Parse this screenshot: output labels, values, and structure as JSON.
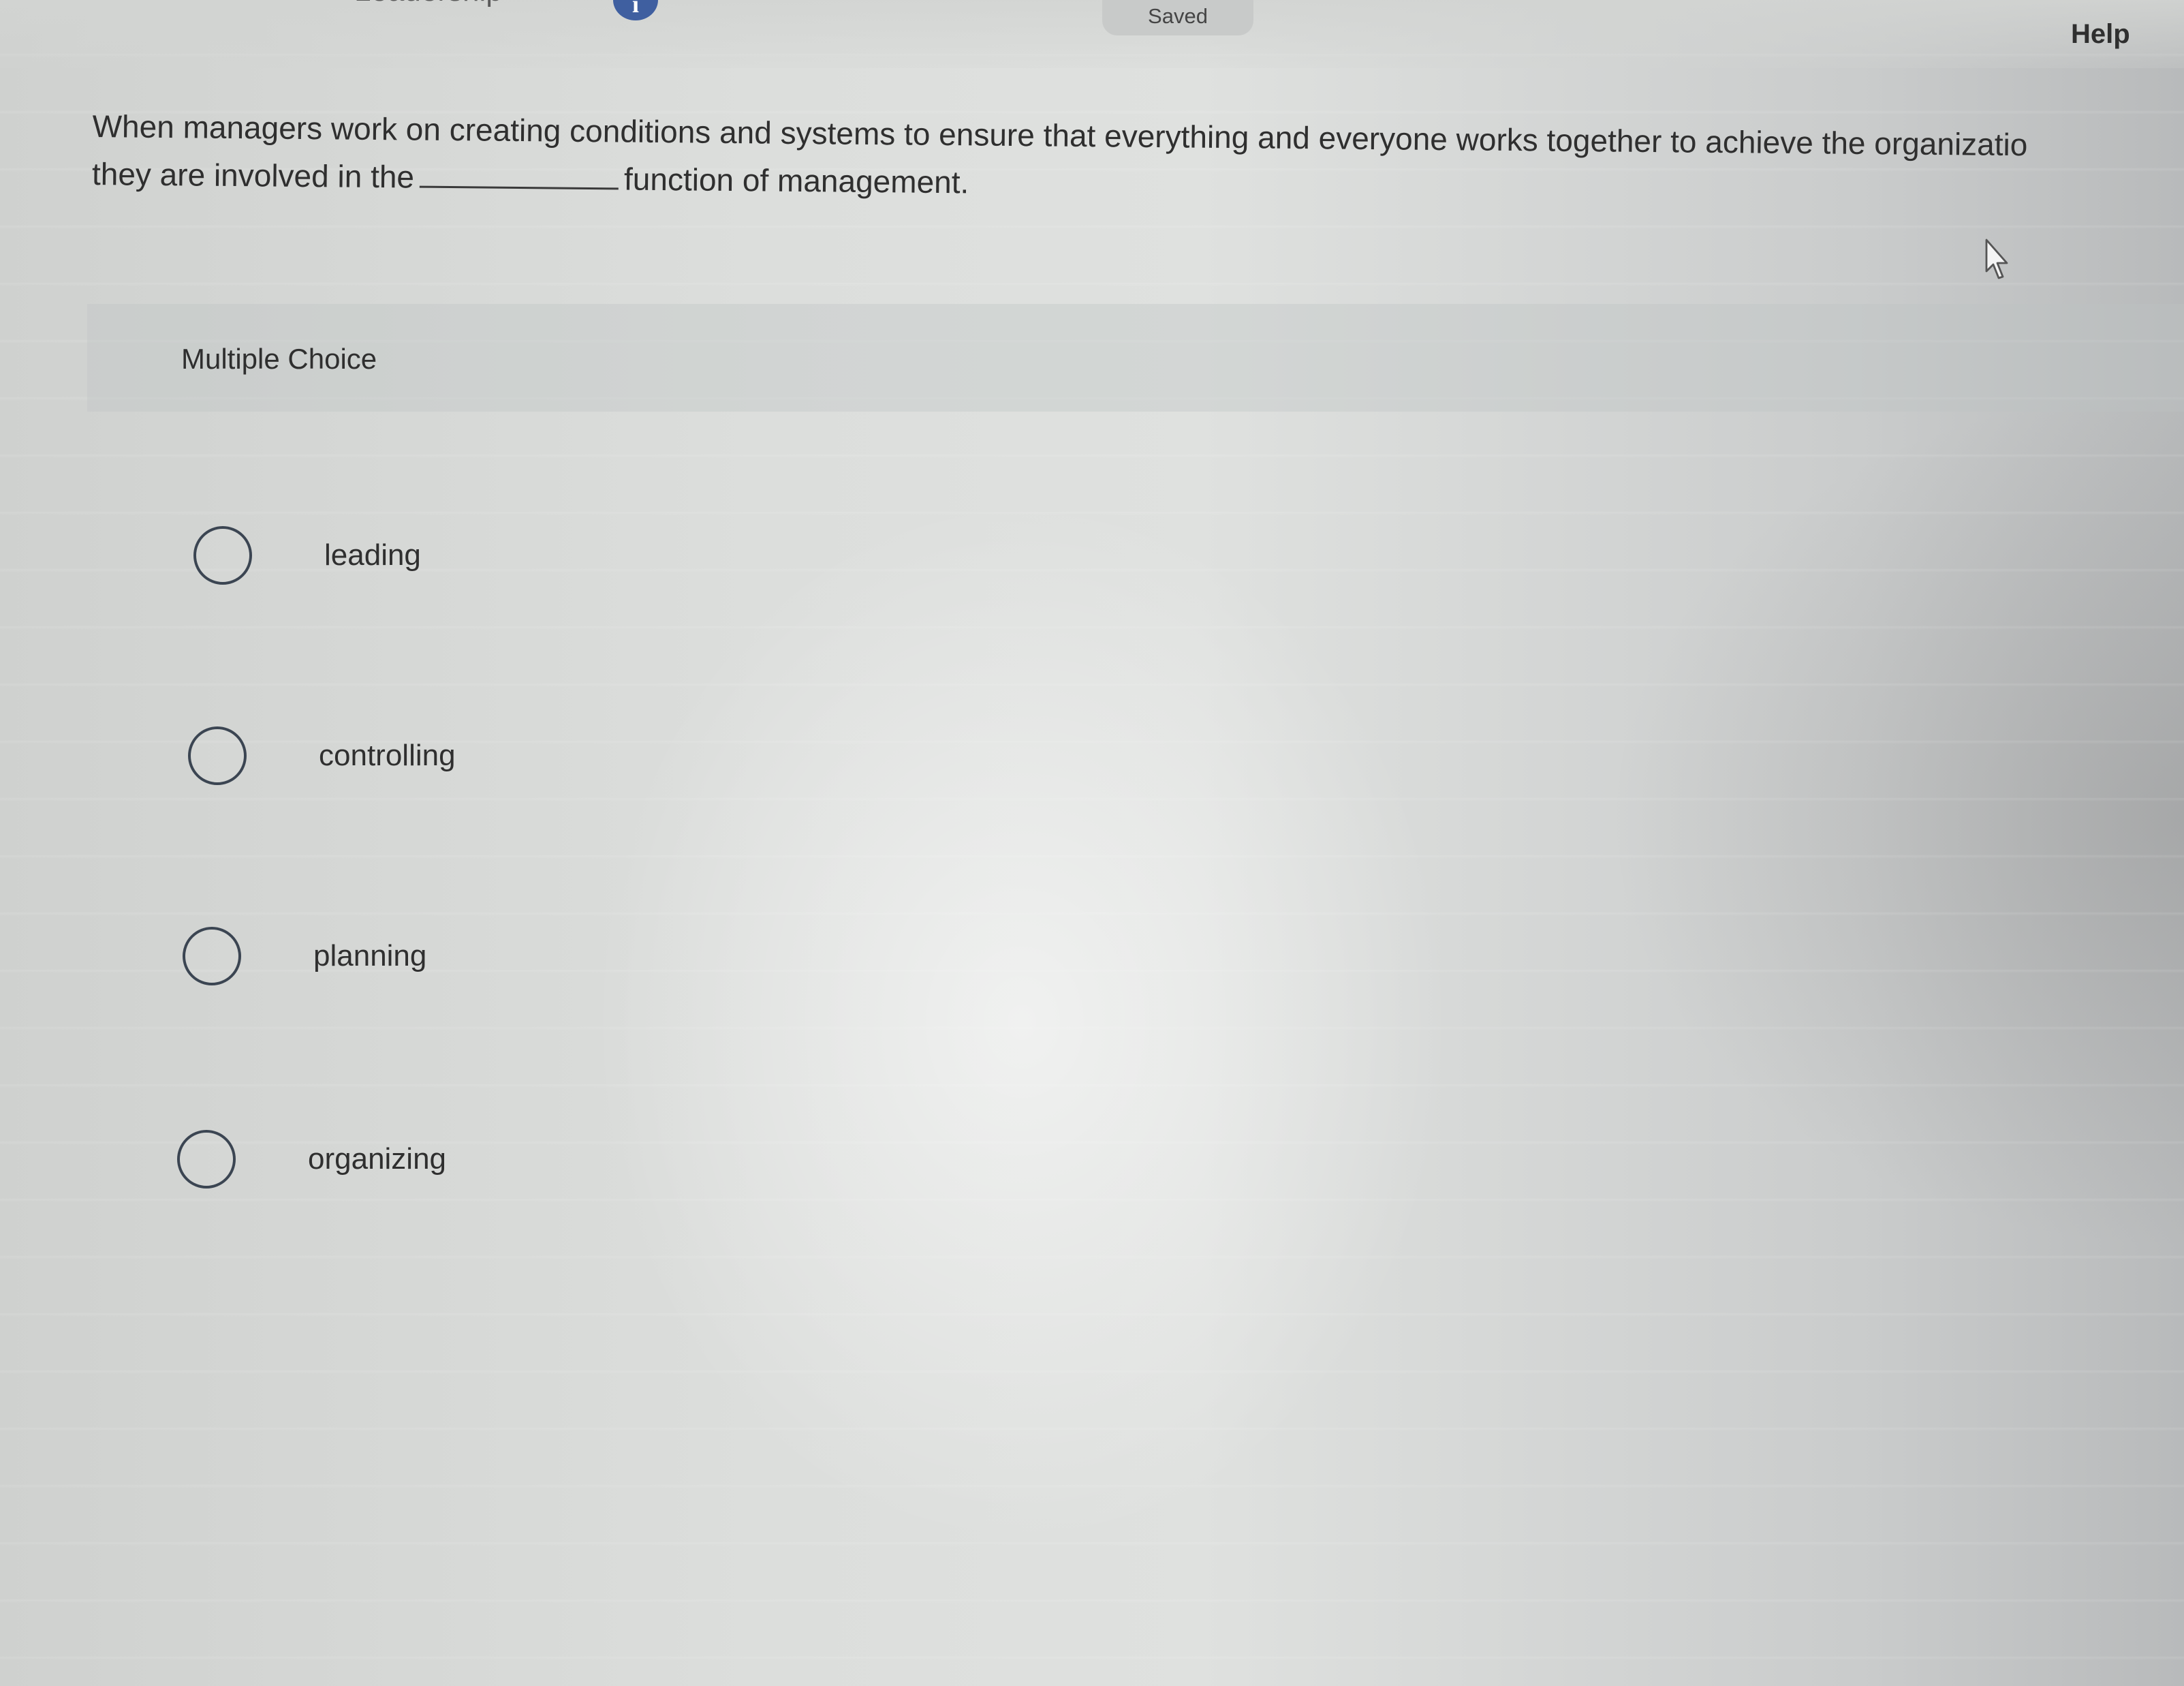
{
  "header": {
    "title_fragment": "Leadership",
    "info_icon": "info-icon",
    "saved_label": "Saved",
    "help_label": "Help"
  },
  "question": {
    "text_before_blank": "When managers work on creating conditions and systems to ensure that everything and everyone works together to achieve the organizatio",
    "line2_prefix": "they are involved in the",
    "text_after_blank": "function of management."
  },
  "multiple_choice": {
    "label": "Multiple Choice",
    "options": [
      {
        "label": "leading"
      },
      {
        "label": "controlling"
      },
      {
        "label": "planning"
      },
      {
        "label": "organizing"
      }
    ]
  },
  "colors": {
    "info_icon": "#3f5fa0",
    "text": "#2f2f2f",
    "radio_border": "#3b4552"
  }
}
